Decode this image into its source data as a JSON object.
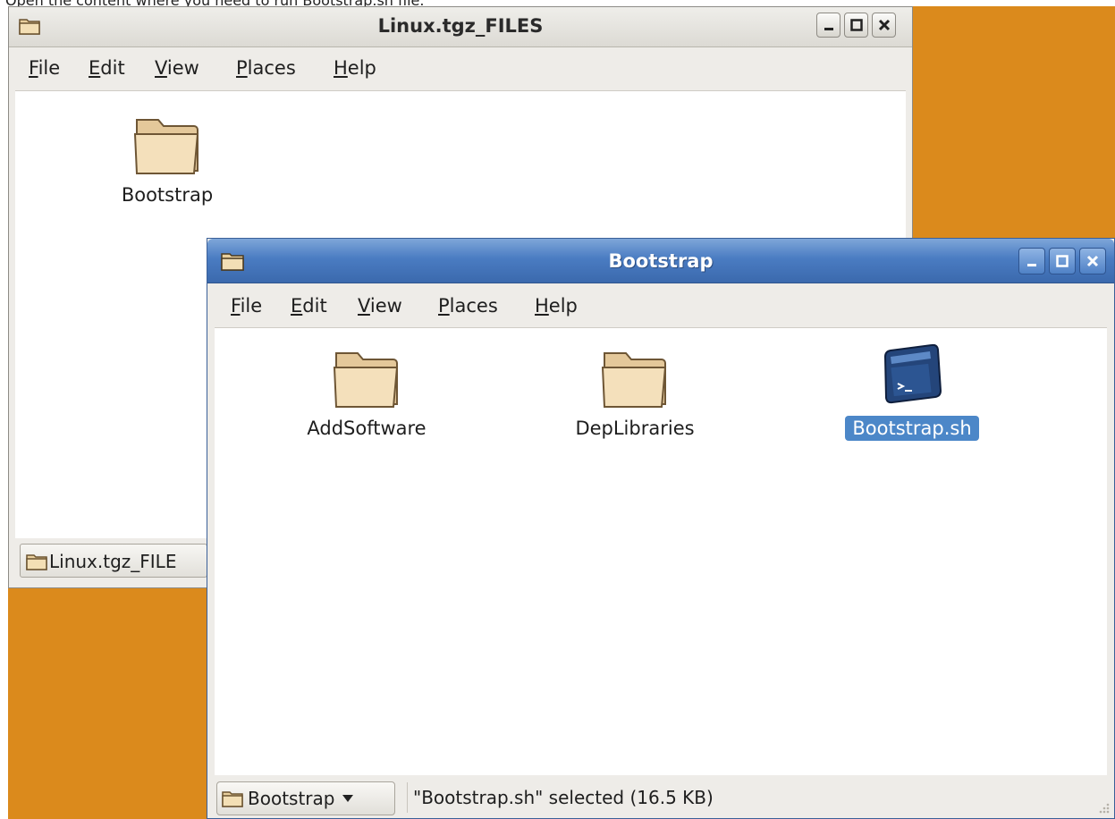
{
  "caption": "Open the content where you need to run Bootstrap.sh file.",
  "colors": {
    "desktop": "#db8a1c",
    "active_titlebar": "#4a7cc2",
    "selection": "#4c87c8"
  },
  "window_back": {
    "title": "Linux.tgz_FILES",
    "menu": [
      {
        "mnemonic": "F",
        "rest": "ile"
      },
      {
        "mnemonic": "E",
        "rest": "dit"
      },
      {
        "mnemonic": "V",
        "rest": "iew"
      },
      {
        "mnemonic": "P",
        "rest": "laces"
      },
      {
        "mnemonic": "H",
        "rest": "elp"
      }
    ],
    "items": [
      {
        "label": "Bootstrap",
        "icon": "folder-icon"
      }
    ],
    "status_path": "Linux.tgz_FILE"
  },
  "window_front": {
    "title": "Bootstrap",
    "menu": [
      {
        "mnemonic": "F",
        "rest": "ile"
      },
      {
        "mnemonic": "E",
        "rest": "dit"
      },
      {
        "mnemonic": "V",
        "rest": "iew"
      },
      {
        "mnemonic": "P",
        "rest": "laces"
      },
      {
        "mnemonic": "H",
        "rest": "elp"
      }
    ],
    "items": [
      {
        "label": "AddSoftware",
        "icon": "folder-icon"
      },
      {
        "label": "DepLibraries",
        "icon": "folder-icon"
      },
      {
        "label": "Bootstrap.sh",
        "icon": "terminal-script-icon",
        "selected": true
      }
    ],
    "path_button": "Bootstrap",
    "status": "\"Bootstrap.sh\" selected (16.5 KB)"
  }
}
